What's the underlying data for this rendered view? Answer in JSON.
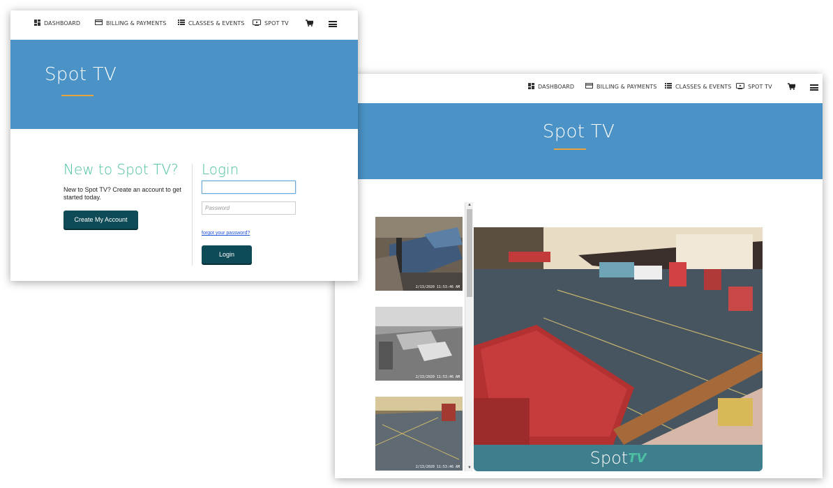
{
  "nav": {
    "items": [
      {
        "label": "DASHBOARD",
        "icon": "dashboard-icon"
      },
      {
        "label": "BILLING & PAYMENTS",
        "icon": "credit-card-icon"
      },
      {
        "label": "CLASSES & EVENTS",
        "icon": "list-icon"
      },
      {
        "label": "SPOT TV",
        "icon": "tv-icon"
      }
    ],
    "cart_icon": "cart-icon",
    "menu_icon": "hamburger-menu-icon"
  },
  "login_page": {
    "hero_title": "Spot TV",
    "new_title": "New to Spot TV?",
    "new_text": "New to Spot TV? Create an account to get started today.",
    "create_button": "Create My Account",
    "login_title": "Login",
    "username_value": "",
    "password_placeholder": "Password",
    "forgot_link": "forgot your password?",
    "login_button": "Login"
  },
  "tv_page": {
    "hero_title": "Spot TV",
    "thumbnails": [
      {
        "camera": "gym-camera-1",
        "timestamp": "2/13/2020 11:53:46 AM"
      },
      {
        "camera": "gym-camera-2",
        "timestamp": "2/13/2020 11:53:46 AM"
      },
      {
        "camera": "gym-camera-3",
        "timestamp": "2/13/2020 11:53:46 AM"
      }
    ],
    "logo_spot": "Spot",
    "logo_tv": "TV"
  },
  "colors": {
    "hero_blue": "#4b93c7",
    "accent_orange": "#e8a33d",
    "heading_teal": "#4cc0a3",
    "button_dark": "#0e4b56"
  }
}
